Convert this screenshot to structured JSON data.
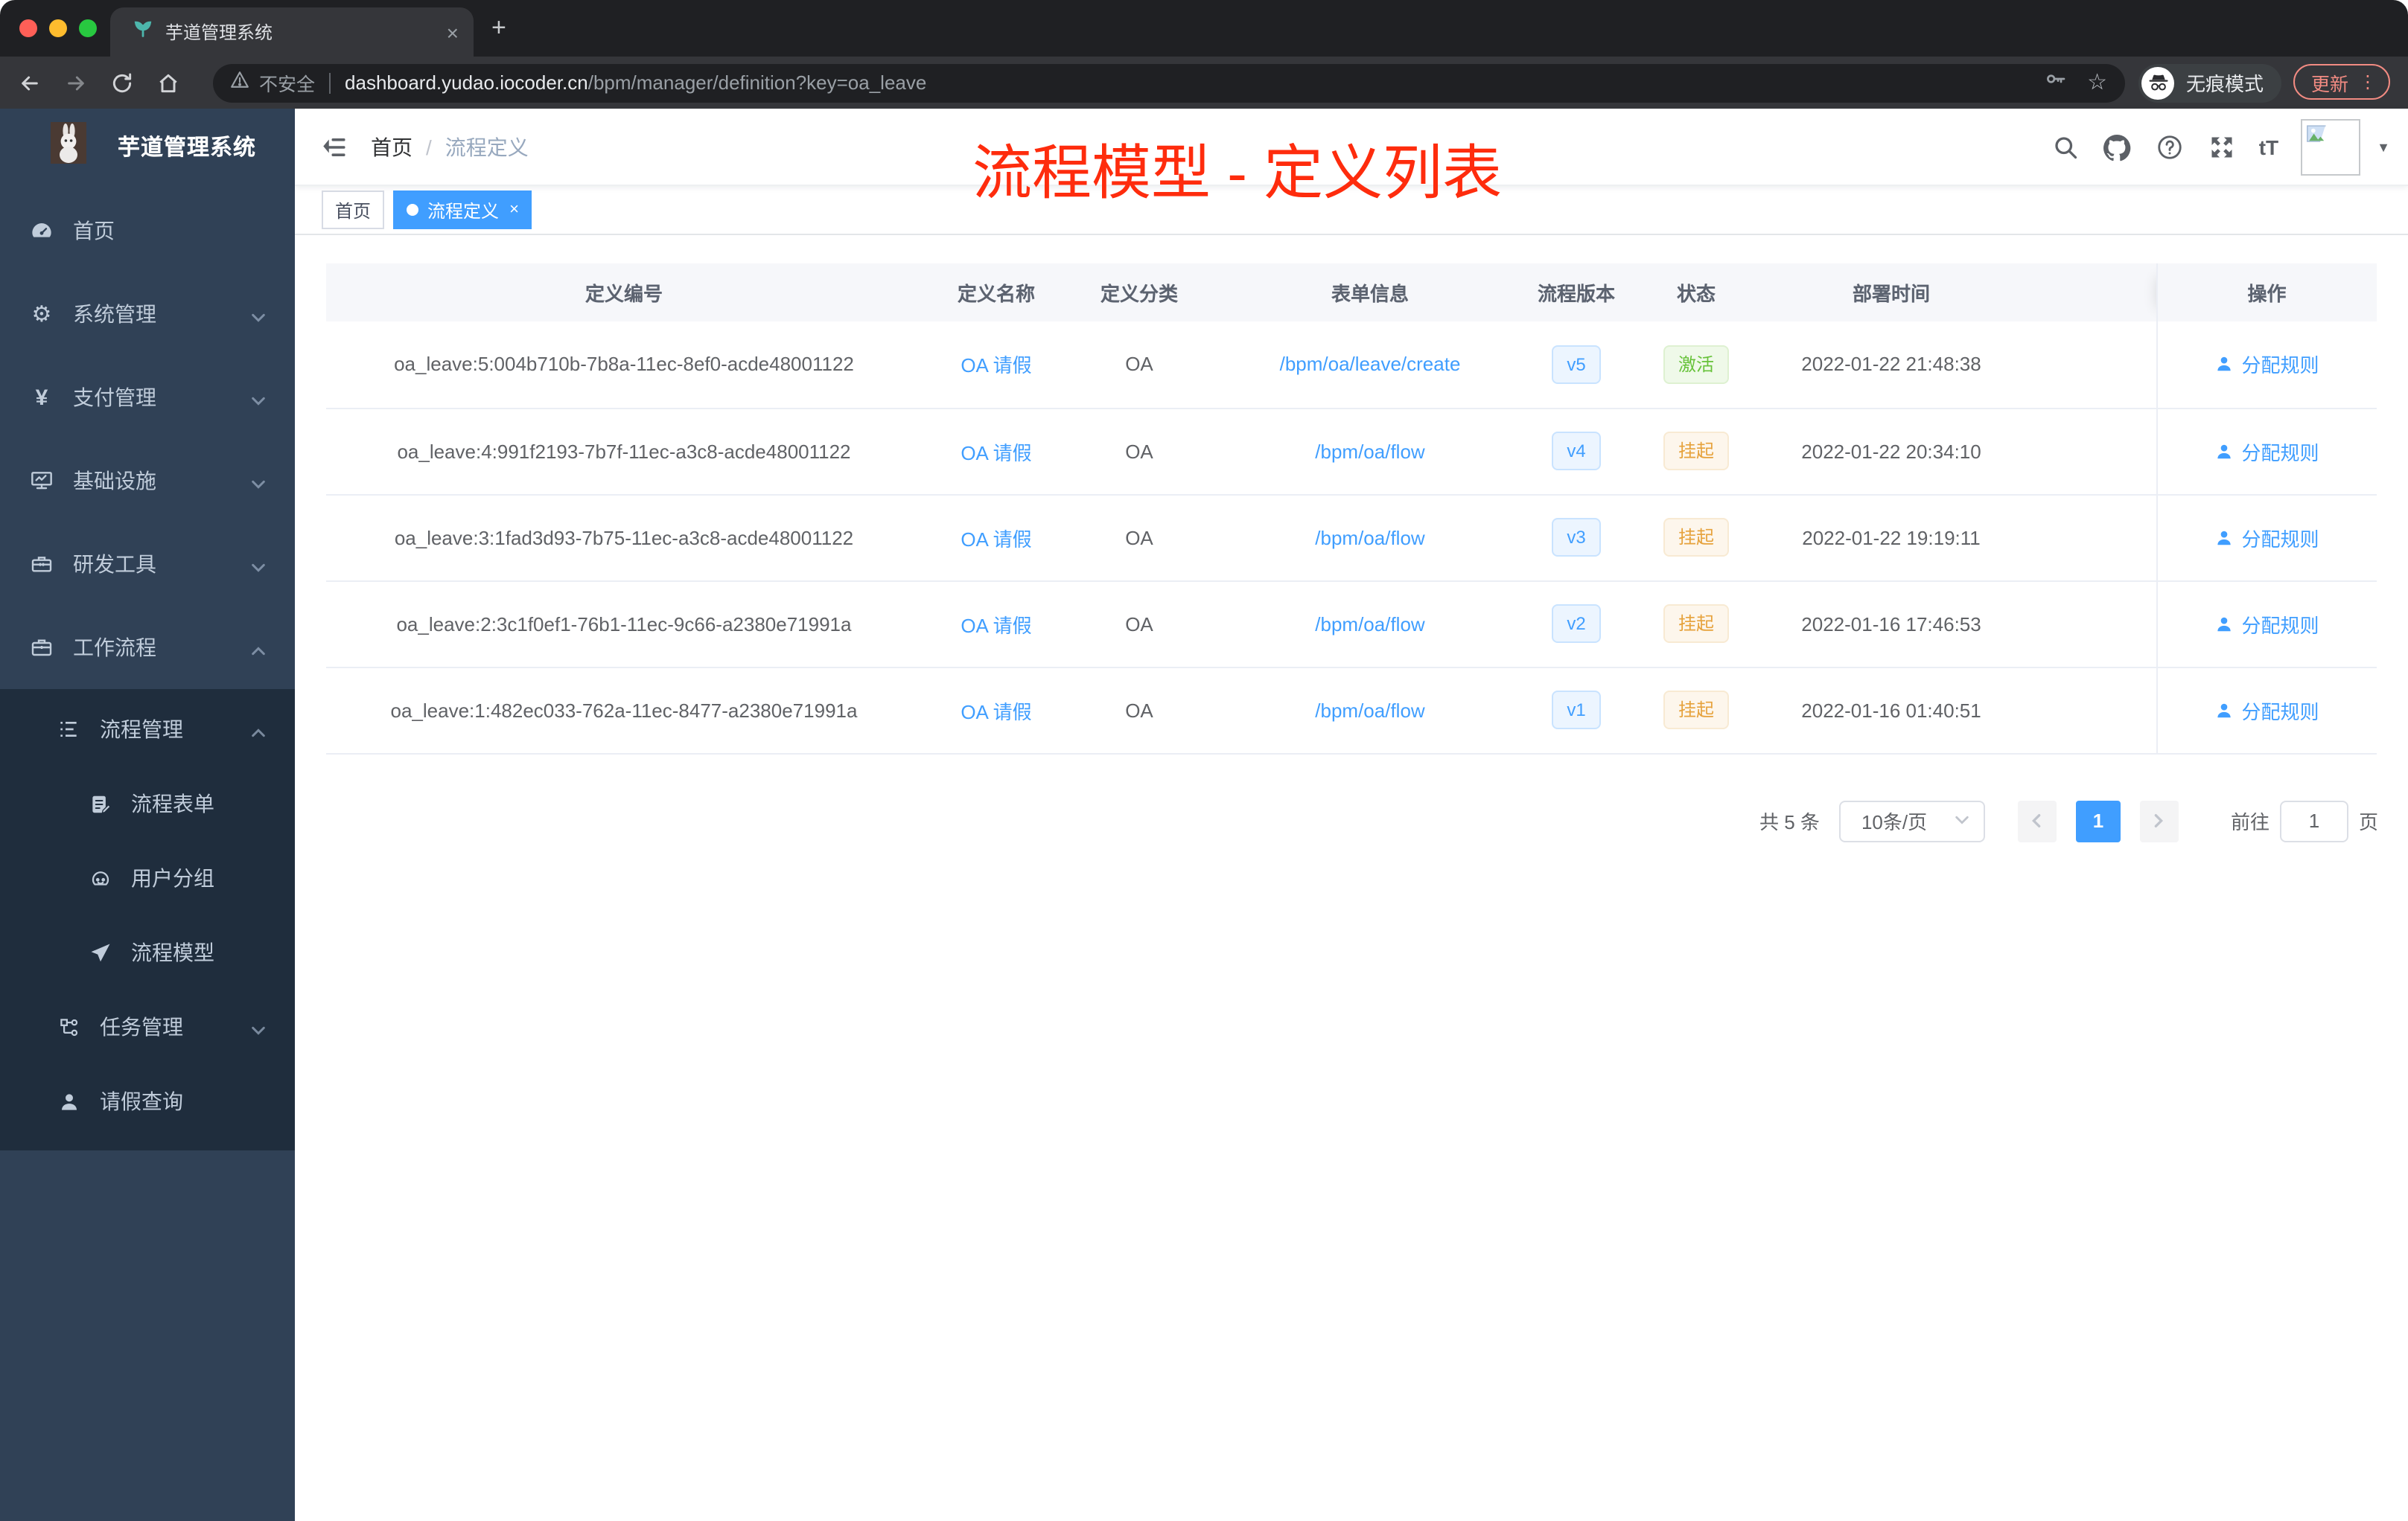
{
  "colors": {
    "accent": "#409eff",
    "annotation_red": "#fe2c0d",
    "status_active_green": "#67c23a",
    "status_suspended_orange": "#e6a23c",
    "sidebar_bg": "#304156",
    "submenu_bg": "#1f2d3d",
    "chrome_dark": "#1f2023",
    "chrome_toolbar": "#35363a",
    "update_red": "#f28b82"
  },
  "icons": {
    "close": "×",
    "new_tab": "+",
    "more_vertical": "⋮",
    "gear": "⚙",
    "yen": "¥",
    "star": "☆",
    "caret_down": "▼",
    "select_caret": "˅",
    "prev_arrow": "‹",
    "next_arrow": "›",
    "text_size": "tT"
  },
  "browser": {
    "tab_title": "芋道管理系统",
    "security_label": "不安全",
    "url_host": "dashboard.yudao.iocoder.cn",
    "url_path": "/bpm/manager/definition?key=oa_leave",
    "incognito_label": "无痕模式",
    "update_label": "更新"
  },
  "sidebar": {
    "app_title": "芋道管理系统",
    "items": [
      {
        "label": "首页"
      },
      {
        "label": "系统管理"
      },
      {
        "label": "支付管理"
      },
      {
        "label": "基础设施"
      },
      {
        "label": "研发工具"
      },
      {
        "label": "工作流程"
      }
    ],
    "sub_items": [
      {
        "label": "流程管理"
      },
      {
        "label": "流程表单"
      },
      {
        "label": "用户分组"
      },
      {
        "label": "流程模型"
      },
      {
        "label": "任务管理"
      },
      {
        "label": "请假查询"
      }
    ]
  },
  "header": {
    "breadcrumb": [
      "首页",
      "流程定义"
    ],
    "breadcrumb_separator": "/",
    "annotation": "流程模型 - 定义列表"
  },
  "tags": {
    "home": "首页",
    "active": "流程定义"
  },
  "table": {
    "columns": [
      "定义编号",
      "定义名称",
      "定义分类",
      "表单信息",
      "流程版本",
      "状态",
      "部署时间",
      "操作"
    ],
    "rows": [
      {
        "id": "oa_leave:5:004b710b-7b8a-11ec-8ef0-acde48001122",
        "name": "OA 请假",
        "category": "OA",
        "form": "/bpm/oa/leave/create",
        "version": "v5",
        "status": "激活",
        "time": "2022-01-22 21:48:38",
        "action": "分配规则"
      },
      {
        "id": "oa_leave:4:991f2193-7b7f-11ec-a3c8-acde48001122",
        "name": "OA 请假",
        "category": "OA",
        "form": "/bpm/oa/flow",
        "version": "v4",
        "status": "挂起",
        "time": "2022-01-22 20:34:10",
        "action": "分配规则"
      },
      {
        "id": "oa_leave:3:1fad3d93-7b75-11ec-a3c8-acde48001122",
        "name": "OA 请假",
        "category": "OA",
        "form": "/bpm/oa/flow",
        "version": "v3",
        "status": "挂起",
        "time": "2022-01-22 19:19:11",
        "action": "分配规则"
      },
      {
        "id": "oa_leave:2:3c1f0ef1-76b1-11ec-9c66-a2380e71991a",
        "name": "OA 请假",
        "category": "OA",
        "form": "/bpm/oa/flow",
        "version": "v2",
        "status": "挂起",
        "time": "2022-01-16 17:46:53",
        "action": "分配规则"
      },
      {
        "id": "oa_leave:1:482ec033-762a-11ec-8477-a2380e71991a",
        "name": "OA 请假",
        "category": "OA",
        "form": "/bpm/oa/flow",
        "version": "v1",
        "status": "挂起",
        "time": "2022-01-16 01:40:51",
        "action": "分配规则"
      }
    ]
  },
  "pagination": {
    "total": "共 5 条",
    "page_size": "10条/页",
    "current_page": "1",
    "goto_label": "前往",
    "goto_value": "1",
    "page_unit": "页"
  }
}
